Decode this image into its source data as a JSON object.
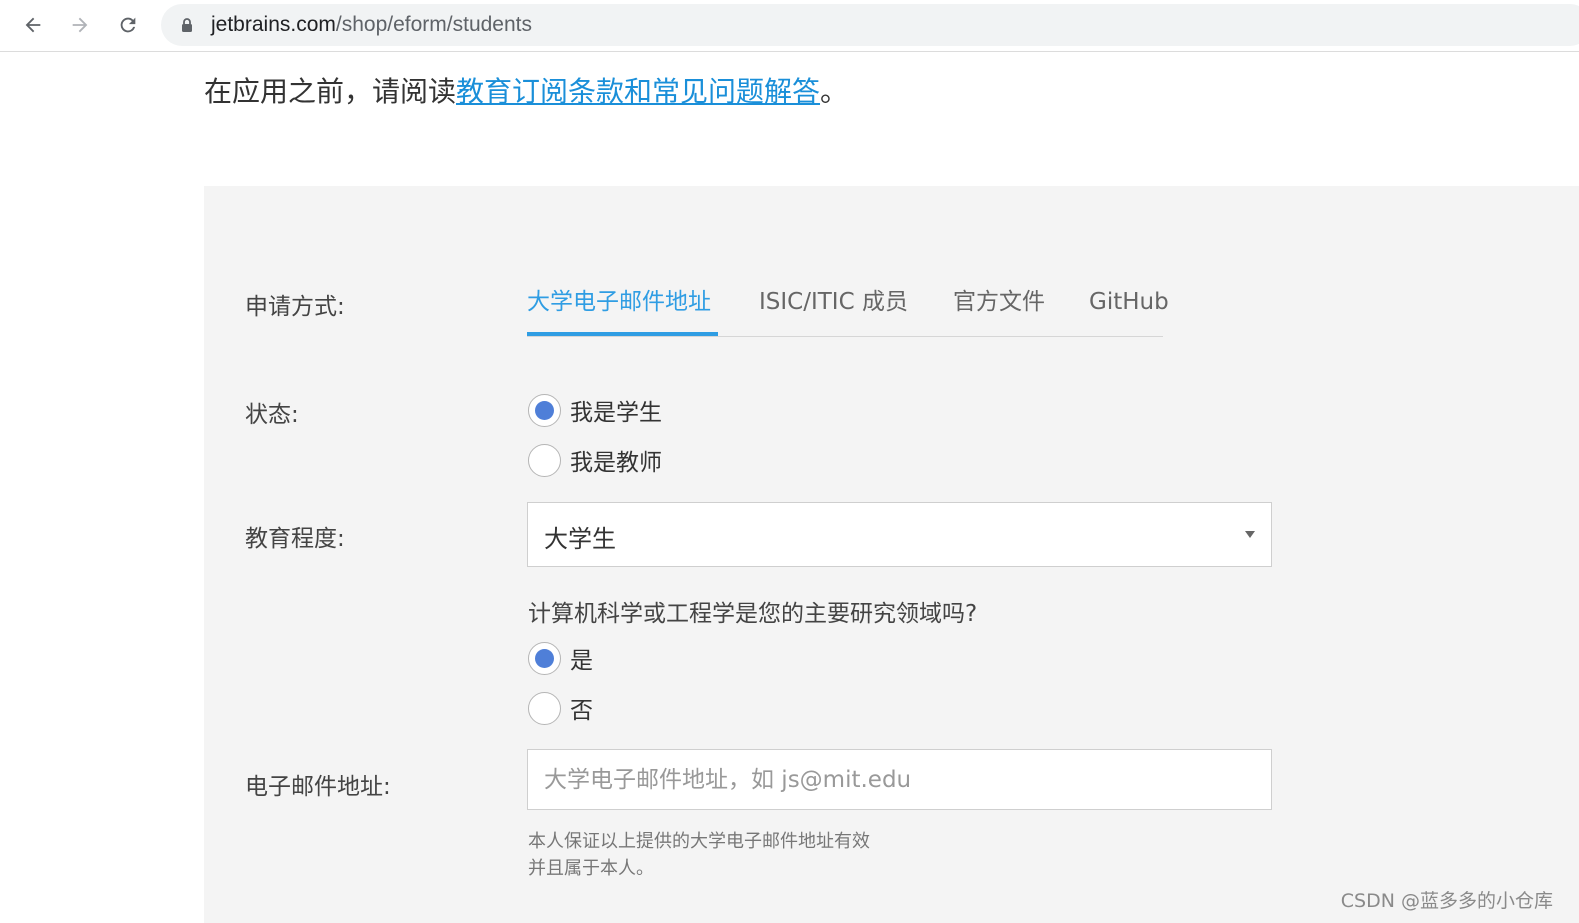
{
  "browser": {
    "url_host": "jetbrains.com",
    "url_path": "/shop/eform/students",
    "icons": [
      "back-arrow-icon",
      "forward-arrow-icon",
      "reload-icon",
      "lock-icon"
    ]
  },
  "intro": {
    "prefix": "在应用之前，请阅读",
    "link": "教育订阅条款和常见问题解答",
    "suffix": "。"
  },
  "form": {
    "method_label": "申请方式:",
    "tabs": [
      {
        "label": "大学电子邮件地址",
        "active": true
      },
      {
        "label": "ISIC/ITIC 成员",
        "active": false
      },
      {
        "label": "官方文件",
        "active": false
      },
      {
        "label": "GitHub",
        "active": false
      }
    ],
    "status_label": "状态:",
    "status_options": [
      {
        "label": "我是学生",
        "checked": true
      },
      {
        "label": "我是教师",
        "checked": false
      }
    ],
    "education_label": "教育程度:",
    "education_value": "大学生",
    "cs_question": "计算机科学或工程学是您的主要研究领域吗?",
    "cs_options": [
      {
        "label": "是",
        "checked": true
      },
      {
        "label": "否",
        "checked": false
      }
    ],
    "email_label": "电子邮件地址:",
    "email_placeholder": "大学电子邮件地址，如 js@mit.edu",
    "note_line1": "本人保证以上提供的大学电子邮件地址有效",
    "note_line2": "并且属于本人。"
  },
  "watermark": "CSDN @蓝多多的小仓库",
  "colors": {
    "accent": "#2f9de3",
    "link": "#1a8fd9",
    "radio_checked": "#4f7fd8",
    "panel_bg": "#f4f4f4"
  }
}
